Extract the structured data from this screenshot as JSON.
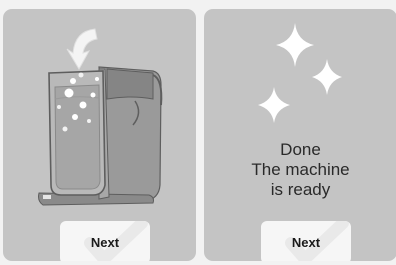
{
  "steps": [
    {
      "id": "insert-cartridge",
      "button_label": "Next"
    },
    {
      "id": "done",
      "heading": "Done",
      "message_line1": "The machine",
      "message_line2": "is ready",
      "button_label": "Next"
    }
  ],
  "icons": {
    "left": "machine-water-tank-insert-illustration",
    "right": "sparkle-icons"
  },
  "colors": {
    "panel_bg": "#c4c4c4",
    "button_bg": "#f6f6f6",
    "text": "#2a2a2a"
  }
}
